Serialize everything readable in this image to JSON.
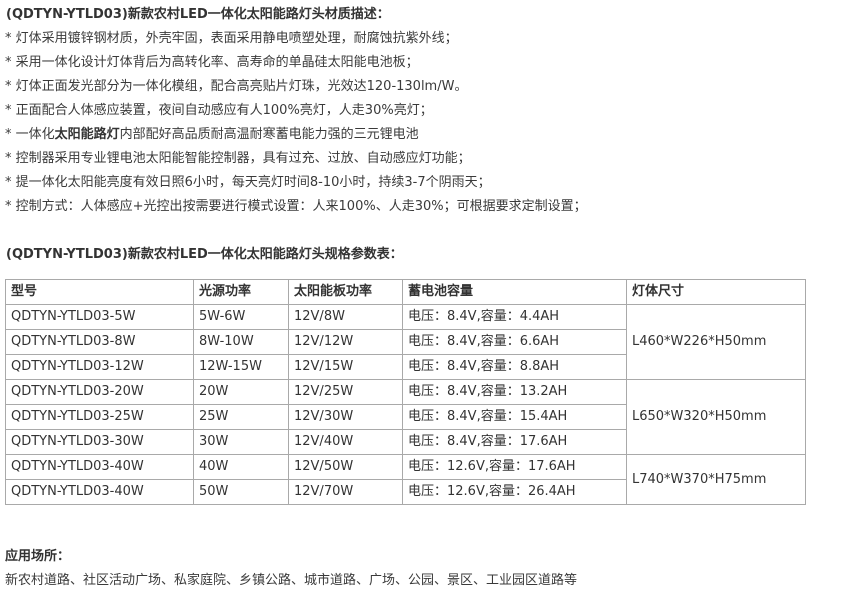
{
  "materials": {
    "title": "(QDTYN-YTLD03)新款农村LED一体化太阳能路灯头材质描述：",
    "items": [
      {
        "pre": "* 灯体采用镀锌钢材质，外壳牢固，表面采用静电喷塑处理，耐腐蚀抗紫外线；",
        "bold": "",
        "post": ""
      },
      {
        "pre": "* 采用一体化设计灯体背后为高转化率、高寿命的单晶硅太阳能电池板；",
        "bold": "",
        "post": ""
      },
      {
        "pre": "* 灯体正面发光部分为一体化模组，配合高亮贴片灯珠，光效达120-130lm/W。",
        "bold": "",
        "post": ""
      },
      {
        "pre": "* 正面配合人体感应装置，夜间自动感应有人100%亮灯，人走30%亮灯；",
        "bold": "",
        "post": ""
      },
      {
        "pre": "* 一体化",
        "bold": "太阳能路灯",
        "post": "内部配好高品质耐高温耐寒蓄电能力强的三元锂电池"
      },
      {
        "pre": "* 控制器采用专业锂电池太阳能智能控制器，具有过充、过放、自动感应灯功能；",
        "bold": "",
        "post": ""
      },
      {
        "pre": "* 提一体化太阳能亮度有效日照6小时，每天亮灯时间8-10小时，持续3-7个阴雨天；",
        "bold": "",
        "post": ""
      },
      {
        "pre": "* 控制方式：人体感应+光控出按需要进行模式设置：人来100%、人走30%；可根据要求定制设置；",
        "bold": "",
        "post": ""
      }
    ]
  },
  "spec": {
    "title": "(QDTYN-YTLD03)新款农村LED一体化太阳能路灯头规格参数表：",
    "headers": [
      "型号",
      "光源功率",
      "太阳能板功率",
      "蓄电池容量",
      "灯体尺寸"
    ],
    "rows": [
      [
        "QDTYN-YTLD03-5W",
        "5W-6W",
        "12V/8W",
        "电压：8.4V,容量：4.4AH"
      ],
      [
        "QDTYN-YTLD03-8W",
        "8W-10W",
        "12V/12W",
        "电压：8.4V,容量：6.6AH"
      ],
      [
        "QDTYN-YTLD03-12W",
        "12W-15W",
        "12V/15W",
        "电压：8.4V,容量：8.8AH"
      ],
      [
        "QDTYN-YTLD03-20W",
        "20W",
        "12V/25W",
        "电压：8.4V,容量：13.2AH"
      ],
      [
        "QDTYN-YTLD03-25W",
        "25W",
        "12V/30W",
        "电压：8.4V,容量：15.4AH"
      ],
      [
        "QDTYN-YTLD03-30W",
        "30W",
        "12V/40W",
        "电压：8.4V,容量：17.6AH"
      ],
      [
        "QDTYN-YTLD03-40W",
        "40W",
        "12V/50W",
        "电压：12.6V,容量：17.6AH"
      ],
      [
        "QDTYN-YTLD03-40W",
        "50W",
        "12V/70W",
        "电压：12.6V,容量：26.4AH"
      ]
    ],
    "sizes": [
      "L460*W226*H50mm",
      "L650*W320*H50mm",
      "L740*W370*H75mm"
    ]
  },
  "applications": {
    "title": "应用场所：",
    "text": "新农村道路、社区活动广场、私家庭院、乡镇公路、城市道路、广场、公园、景区、工业园区道路等"
  }
}
